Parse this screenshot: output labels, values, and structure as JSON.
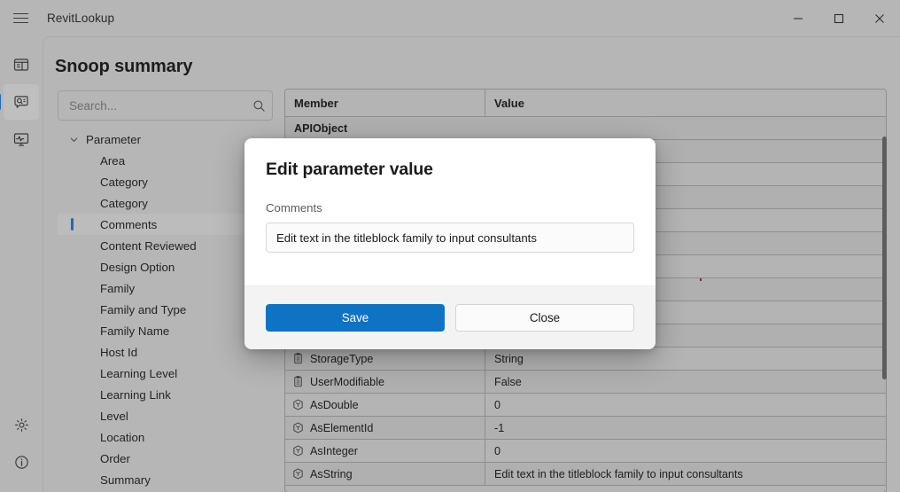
{
  "window": {
    "title": "RevitLookup",
    "menu_icon": "hamburger-icon",
    "minimize_label": "Minimize",
    "maximize_label": "Maximize",
    "close_label": "Close"
  },
  "rail": {
    "top_items": [
      {
        "name": "snoop-dashboard",
        "icon": "dashboard-panel-icon",
        "active": false
      },
      {
        "name": "snoop-summary",
        "icon": "comment-search-icon",
        "active": true
      },
      {
        "name": "snoop-events",
        "icon": "monitor-pulse-icon",
        "active": false
      }
    ],
    "bottom_items": [
      {
        "name": "settings",
        "icon": "gear-icon",
        "active": false
      },
      {
        "name": "about",
        "icon": "info-circle-icon",
        "active": false
      }
    ]
  },
  "page": {
    "title": "Snoop summary"
  },
  "search": {
    "placeholder": "Search...",
    "value": "",
    "icon": "search-icon"
  },
  "tree": {
    "root": {
      "label": "Parameter",
      "expanded": true,
      "chevron": "chevron-down-icon"
    },
    "items": [
      {
        "label": "Area",
        "selected": false
      },
      {
        "label": "Category",
        "selected": false
      },
      {
        "label": "Category",
        "selected": false
      },
      {
        "label": "Comments",
        "selected": true
      },
      {
        "label": "Content Reviewed",
        "selected": false
      },
      {
        "label": "Design Option",
        "selected": false
      },
      {
        "label": "Family",
        "selected": false
      },
      {
        "label": "Family and Type",
        "selected": false
      },
      {
        "label": "Family Name",
        "selected": false
      },
      {
        "label": "Host Id",
        "selected": false
      },
      {
        "label": "Learning Level",
        "selected": false
      },
      {
        "label": "Learning Link",
        "selected": false
      },
      {
        "label": "Level",
        "selected": false
      },
      {
        "label": "Location",
        "selected": false
      },
      {
        "label": "Order",
        "selected": false
      },
      {
        "label": "Summary",
        "selected": false
      }
    ]
  },
  "grid": {
    "columns": [
      "Member",
      "Value"
    ],
    "rows": [
      {
        "type": "section",
        "member": "APIObject",
        "value": "",
        "icon": ""
      },
      {
        "type": "row",
        "member": "",
        "value": "",
        "icon": "property-icon"
      },
      {
        "type": "row",
        "member": "",
        "value": "",
        "icon": "property-icon"
      },
      {
        "type": "row",
        "member": "",
        "value": "",
        "icon": "property-icon"
      },
      {
        "type": "row",
        "member": "",
        "value": "",
        "icon": "property-icon"
      },
      {
        "type": "row",
        "member": "",
        "value": "",
        "icon": "property-icon"
      },
      {
        "type": "row",
        "member": "",
        "value": "",
        "icon": "property-icon"
      },
      {
        "type": "row",
        "member": "",
        "value": "",
        "icon": "property-icon"
      },
      {
        "type": "row",
        "member": "",
        "value": "",
        "icon": "property-icon"
      },
      {
        "type": "row",
        "member": "",
        "value": "",
        "icon": "property-icon"
      },
      {
        "type": "row",
        "member": "StorageType",
        "value": "String",
        "icon": "property-icon"
      },
      {
        "type": "row",
        "member": "UserModifiable",
        "value": "False",
        "icon": "property-icon"
      },
      {
        "type": "row",
        "member": "AsDouble",
        "value": "0",
        "icon": "method-icon"
      },
      {
        "type": "row",
        "member": "AsElementId",
        "value": "-1",
        "icon": "method-icon"
      },
      {
        "type": "row",
        "member": "AsInteger",
        "value": "0",
        "icon": "method-icon"
      },
      {
        "type": "row",
        "member": "AsString",
        "value": "Edit text in the titleblock family to input consultants",
        "icon": "method-icon"
      }
    ]
  },
  "scrollbar": {
    "name": "grid-vertical-scrollbar"
  },
  "modal": {
    "title": "Edit parameter value",
    "field_label": "Comments",
    "field_value": "Edit text in the titleblock family to input consultants",
    "field_placeholder": "",
    "save_label": "Save",
    "close_label": "Close"
  },
  "colors": {
    "accent": "#0f73c4",
    "selection_indicator": "#1f6bb8",
    "window_bg": "#b6b6b6",
    "modal_bg": "#ffffff",
    "modal_footer_bg": "#f3f3f3"
  }
}
